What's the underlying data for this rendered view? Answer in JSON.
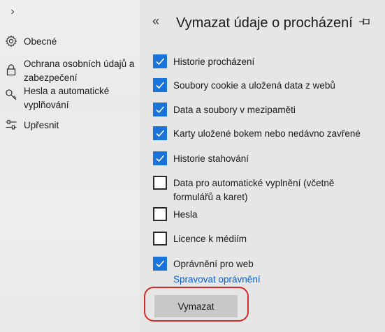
{
  "sidebar": {
    "expand_icon": "chevron-right-icon",
    "items": [
      {
        "id": "general",
        "label": "Obecné",
        "icon": "gear-icon"
      },
      {
        "id": "privacy",
        "label": "Ochrana osobních údajů a zabezpečení",
        "icon": "lock-icon"
      },
      {
        "id": "passwords",
        "label": "Hesla a automatické vyplňování",
        "icon": "key-icon"
      },
      {
        "id": "advanced",
        "label": "Upřesnit",
        "icon": "sliders-icon"
      }
    ]
  },
  "panel": {
    "back_icon": "double-chevron-left-icon",
    "title": "Vymazat údaje o procházení",
    "pin_icon": "pin-icon",
    "options": [
      {
        "label": "Historie procházení",
        "checked": true
      },
      {
        "label": "Soubory cookie a uložená data z webů",
        "checked": true
      },
      {
        "label": "Data a soubory v mezipaměti",
        "checked": true
      },
      {
        "label": "Karty uložené bokem nebo nedávno zavřené",
        "checked": true
      },
      {
        "label": "Historie stahování",
        "checked": true
      },
      {
        "label": "Data pro automatické vyplnění (včetně formulářů a karet)",
        "checked": false
      },
      {
        "label": "Hesla",
        "checked": false
      },
      {
        "label": "Licence k médiím",
        "checked": false
      },
      {
        "label": "Oprávnění pro web",
        "checked": true
      }
    ],
    "manage_link": "Spravovat oprávnění",
    "clear_button": "Vymazat"
  },
  "colors": {
    "accent": "#1a73d9",
    "link": "#0a5fc8",
    "highlight": "#d42a2a",
    "panel_bg": "#e6e6e6"
  }
}
